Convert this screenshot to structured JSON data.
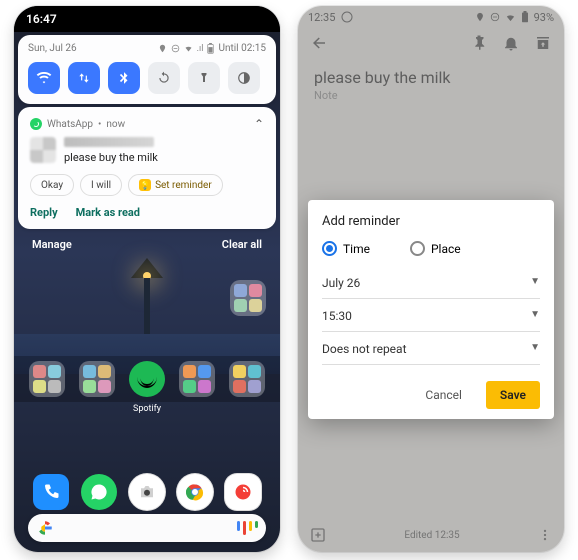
{
  "left": {
    "status_time": "16:47",
    "qs": {
      "date": "Sun, Jul 26",
      "until": "Until 02:15",
      "toggles": [
        "wifi",
        "data",
        "bluetooth",
        "sync",
        "flashlight",
        "darkmode"
      ]
    },
    "notification": {
      "app": "WhatsApp",
      "time_rel": "now",
      "message": "please buy the milk",
      "chips": {
        "okay": "Okay",
        "iwill": "I will",
        "setrem": "Set reminder"
      },
      "reply": "Reply",
      "mark_read": "Mark as read"
    },
    "shade": {
      "manage": "Manage",
      "clear": "Clear all"
    },
    "spotify_label": "Spotify"
  },
  "right": {
    "status": {
      "time": "12:35",
      "battery": "93%"
    },
    "title": "please buy the milk",
    "note_hint": "Note",
    "dialog": {
      "title": "Add reminder",
      "radio_time": "Time",
      "radio_place": "Place",
      "date": "July 26",
      "time": "15:30",
      "repeat": "Does not repeat",
      "cancel": "Cancel",
      "save": "Save"
    },
    "footer_edited": "Edited 12:35"
  }
}
